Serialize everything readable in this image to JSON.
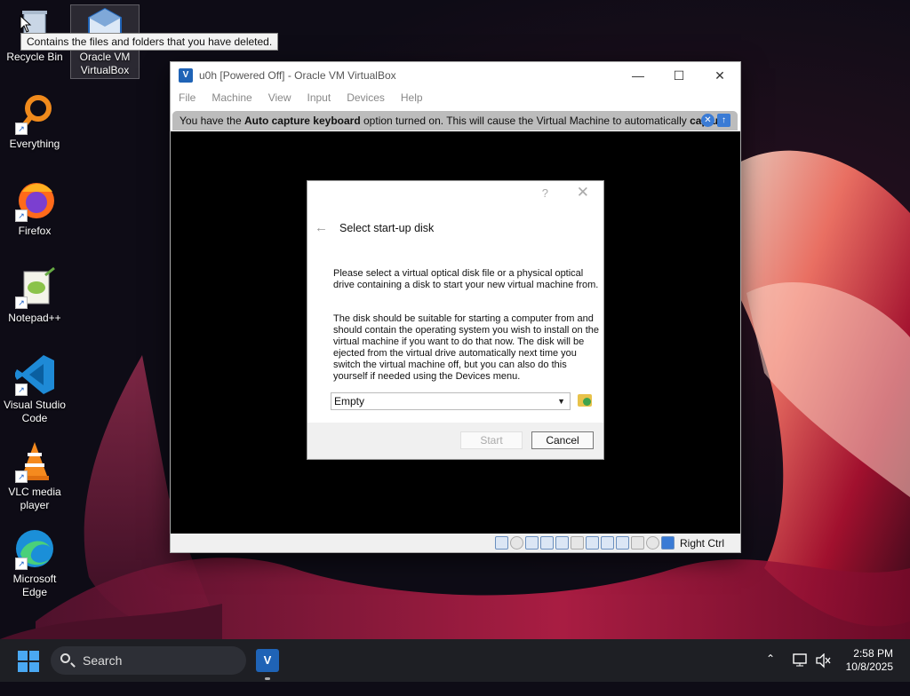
{
  "desktop": {
    "icons": [
      {
        "label": "Recycle Bin",
        "icon": "recycle-bin-icon"
      },
      {
        "label": "Oracle VM VirtualBox",
        "icon": "virtualbox-icon"
      },
      {
        "label": "Everything",
        "icon": "search-magnifier-icon"
      },
      {
        "label": "Firefox",
        "icon": "firefox-icon"
      },
      {
        "label": "Notepad++",
        "icon": "notepad-plus-plus-icon"
      },
      {
        "label": "Visual Studio Code",
        "icon": "vscode-icon"
      },
      {
        "label": "VLC media player",
        "icon": "vlc-icon"
      },
      {
        "label": "Microsoft Edge",
        "icon": "edge-icon"
      }
    ],
    "tooltip": "Contains the files and folders that you have deleted."
  },
  "vbox": {
    "title": "u0h [Powered Off] - Oracle VM VirtualBox",
    "menu": [
      "File",
      "Machine",
      "View",
      "Input",
      "Devices",
      "Help"
    ],
    "banner": {
      "pre": "You have the ",
      "bold1": "Auto capture keyboard",
      "mid": " option turned on. This will cause the Virtual Machine to automatically ",
      "bold2": "capture"
    },
    "host_key": "Right Ctrl"
  },
  "dialog": {
    "help": "?",
    "title": "Select start-up disk",
    "para1": "Please select a virtual optical disk file or a physical optical drive containing a disk to start your new virtual machine from.",
    "para2": "The disk should be suitable for starting a computer from and should contain the operating system you wish to install on the virtual machine if you want to do that now. The disk will be ejected from the virtual drive automatically next time you switch the virtual machine off, but you can also do this yourself if needed using the Devices menu.",
    "selected_disk": "Empty",
    "start_label": "Start",
    "cancel_label": "Cancel"
  },
  "taskbar": {
    "search_placeholder": "Search",
    "time": "2:58 PM",
    "date": "10/8/2025"
  },
  "colors": {
    "accent": "#4aa8f2",
    "vbox_blue": "#1f63b6",
    "taskbar": "#1e1f24"
  }
}
